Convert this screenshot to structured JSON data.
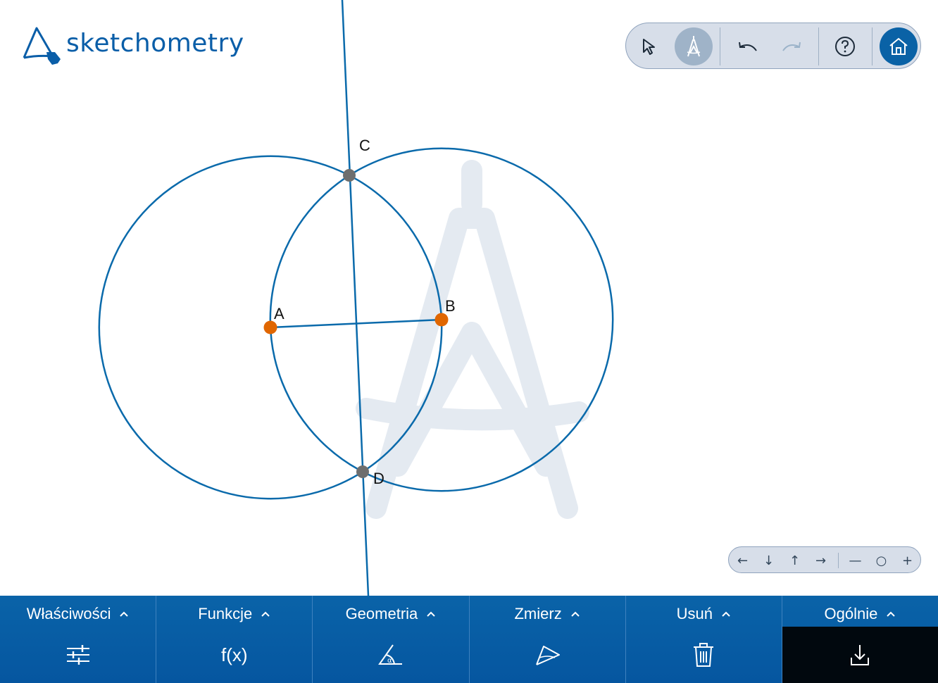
{
  "app": {
    "name": "sketchometry"
  },
  "colors": {
    "accent": "#0a62a6",
    "circle_stroke": "#0a6aab",
    "point_free": "#e06600",
    "point_dependent": "#6e6e6e",
    "watermark": "#e4eaf1",
    "toolbar_bg": "#d7dee9",
    "panel_bg": "#0a62a6",
    "panel_active_bg": "#01080e"
  },
  "toolbar": {
    "buttons": [
      {
        "name": "select",
        "icon": "cursor-icon",
        "active": false
      },
      {
        "name": "construct",
        "icon": "compass-icon",
        "active": true
      },
      {
        "name": "undo",
        "icon": "undo-icon",
        "enabled": true
      },
      {
        "name": "redo",
        "icon": "redo-icon",
        "enabled": false
      },
      {
        "name": "help",
        "icon": "help-icon"
      },
      {
        "name": "home",
        "icon": "home-icon"
      }
    ]
  },
  "navigation": {
    "left": "←",
    "down": "↓",
    "up": "↑",
    "right": "→",
    "zoom_out": "—",
    "zoom_reset": "○",
    "zoom_in": "+"
  },
  "construction": {
    "points": {
      "A": {
        "label": "A",
        "type": "free"
      },
      "B": {
        "label": "B",
        "type": "free"
      },
      "C": {
        "label": "C",
        "type": "intersection"
      },
      "D": {
        "label": "D",
        "type": "intersection"
      }
    },
    "objects": [
      "segment AB",
      "circle centered A through B",
      "circle centered B through A",
      "line CD"
    ]
  },
  "bottom_bar": {
    "panels": [
      {
        "label": "Właściwości",
        "icon": "sliders-icon"
      },
      {
        "label": "Funkcje",
        "icon": "function-icon",
        "text": "f(x)"
      },
      {
        "label": "Geometria",
        "icon": "angle-icon"
      },
      {
        "label": "Zmierz",
        "icon": "measure-icon"
      },
      {
        "label": "Usuń",
        "icon": "trash-icon"
      },
      {
        "label": "Ogólnie",
        "icon": "download-icon",
        "active": true
      }
    ]
  }
}
